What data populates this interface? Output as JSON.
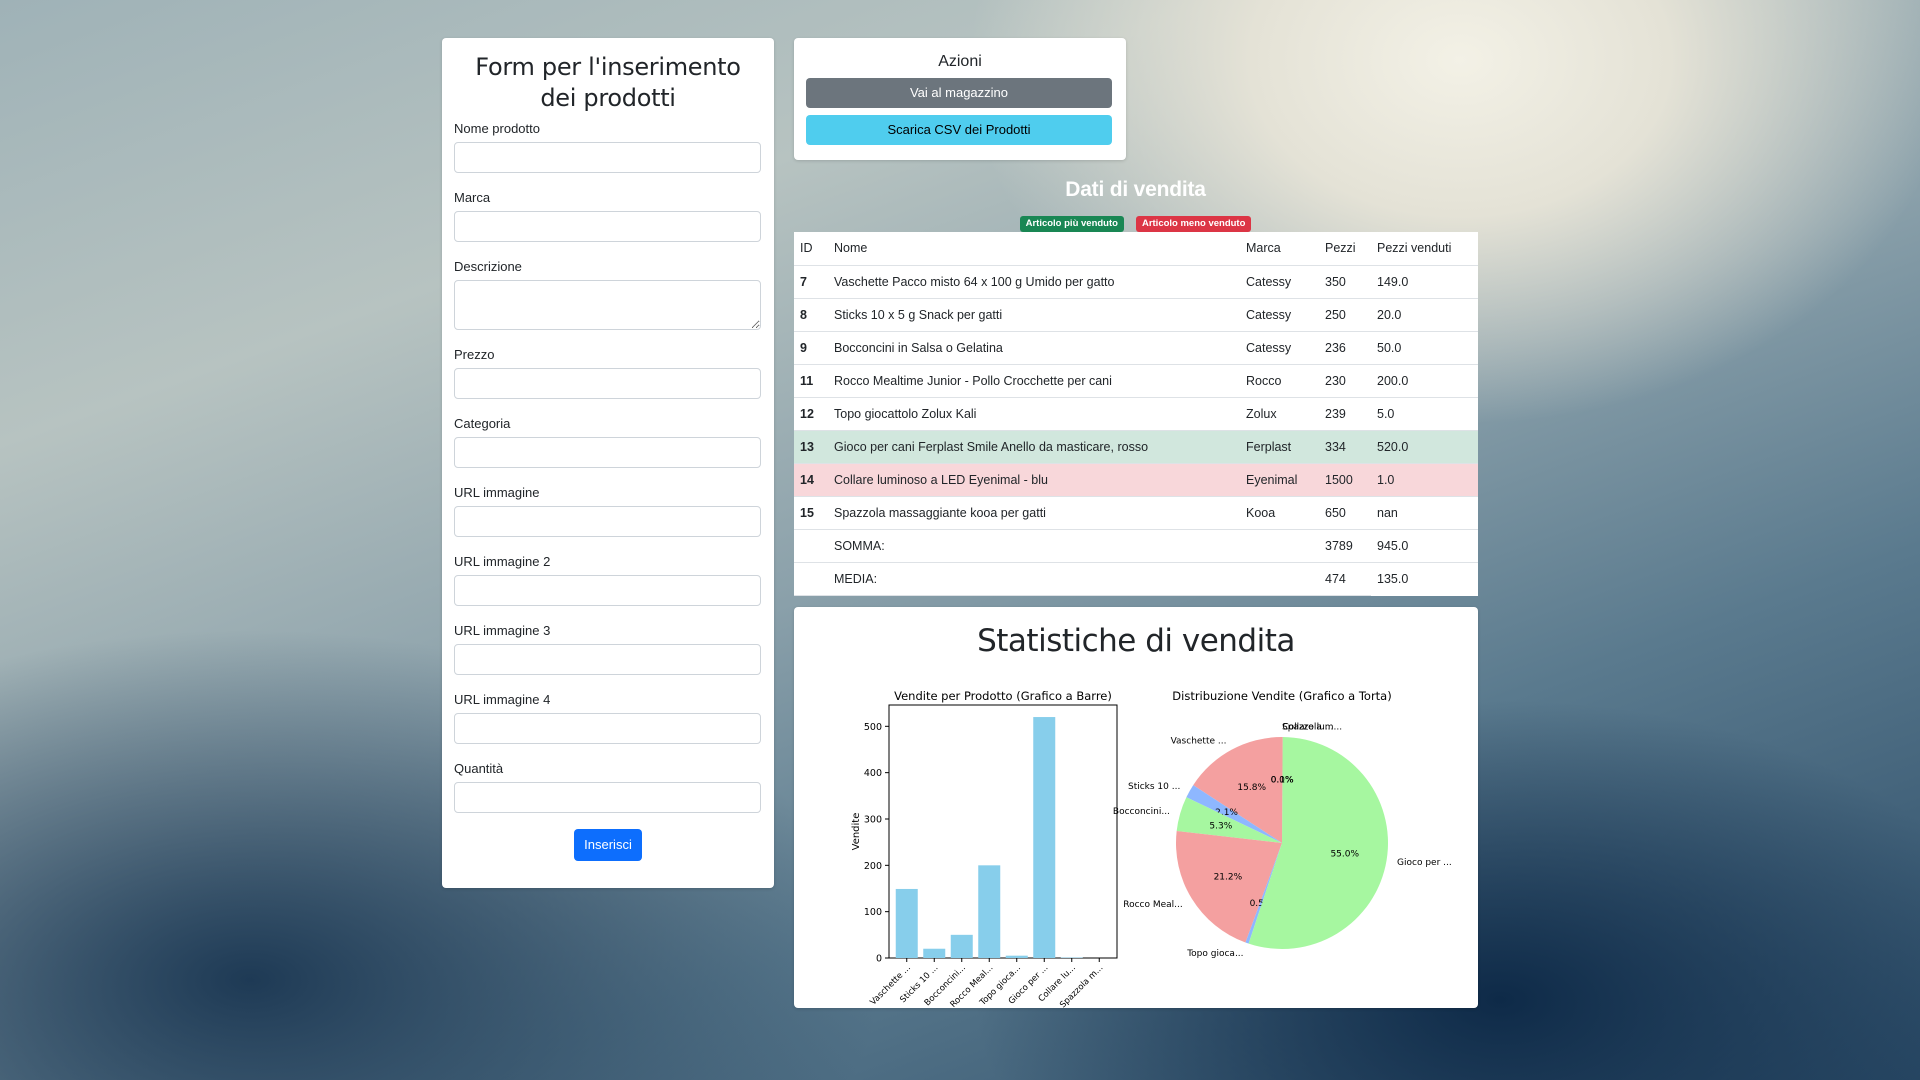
{
  "form": {
    "title": "Form per l'inserimento dei prodotti",
    "fields": [
      {
        "label": "Nome prodotto"
      },
      {
        "label": "Marca"
      },
      {
        "label": "Descrizione"
      },
      {
        "label": "Prezzo"
      },
      {
        "label": "Categoria"
      },
      {
        "label": "URL immagine"
      },
      {
        "label": "URL immagine 2"
      },
      {
        "label": "URL immagine 3"
      },
      {
        "label": "URL immagine 4"
      },
      {
        "label": "Quantità"
      }
    ],
    "submit_label": "Inserisci"
  },
  "actions": {
    "title": "Azioni",
    "warehouse_label": "Vai al magazzino",
    "csv_label": "Scarica CSV dei Prodotti"
  },
  "sales": {
    "title": "Dati di vendita",
    "badge_best": "Articolo più venduto",
    "badge_worst": "Articolo meno venduto",
    "headers": {
      "id": "ID",
      "nome": "Nome",
      "marca": "Marca",
      "pezzi": "Pezzi",
      "venduti": "Pezzi venduti"
    },
    "rows": [
      {
        "id": "7",
        "nome": "Vaschette Pacco misto 64 x 100 g Umido per gatto",
        "marca": "Catessy",
        "pezzi": "350",
        "venduti": "149.0",
        "status": ""
      },
      {
        "id": "8",
        "nome": "Sticks 10 x 5 g Snack per gatti",
        "marca": "Catessy",
        "pezzi": "250",
        "venduti": "20.0",
        "status": ""
      },
      {
        "id": "9",
        "nome": "Bocconcini in Salsa o Gelatina",
        "marca": "Catessy",
        "pezzi": "236",
        "venduti": "50.0",
        "status": ""
      },
      {
        "id": "11",
        "nome": "Rocco Mealtime Junior - Pollo Crocchette per cani",
        "marca": "Rocco",
        "pezzi": "230",
        "venduti": "200.0",
        "status": ""
      },
      {
        "id": "12",
        "nome": "Topo giocattolo Zolux Kali",
        "marca": "Zolux",
        "pezzi": "239",
        "venduti": "5.0",
        "status": ""
      },
      {
        "id": "13",
        "nome": "Gioco per cani Ferplast Smile Anello da masticare, rosso",
        "marca": "Ferplast",
        "pezzi": "334",
        "venduti": "520.0",
        "status": "best"
      },
      {
        "id": "14",
        "nome": "Collare luminoso a LED Eyenimal - blu",
        "marca": "Eyenimal",
        "pezzi": "1500",
        "venduti": "1.0",
        "status": "worst"
      },
      {
        "id": "15",
        "nome": "Spazzola massaggiante kooa per gatti",
        "marca": "Kooa",
        "pezzi": "650",
        "venduti": "nan",
        "status": ""
      }
    ],
    "totals": [
      {
        "label": "SOMMA:",
        "pezzi": "3789",
        "venduti": "945.0"
      },
      {
        "label": "MEDIA:",
        "pezzi": "474",
        "venduti": "135.0"
      }
    ]
  },
  "stats": {
    "title": "Statistiche di vendita"
  },
  "colors": {
    "bar": "#87ceeb",
    "pie_red": "#f4a0a0",
    "pie_green": "#a6f7a0",
    "pie_blue": "#8eb7ff"
  },
  "chart_data": [
    {
      "type": "bar",
      "title": "Vendite per Prodotto (Grafico a Barre)",
      "xlabel": "",
      "ylabel": "Vendite",
      "categories": [
        "Vaschette ...",
        "Sticks 10 ...",
        "Bocconcini...",
        "Rocco Meal...",
        "Topo gioca...",
        "Gioco per ...",
        "Collare lu...",
        "Spazzola m..."
      ],
      "values": [
        149,
        20,
        50,
        200,
        5,
        520,
        1,
        0
      ],
      "ylim": [
        0,
        546
      ],
      "yticks": [
        0,
        100,
        200,
        300,
        400,
        500
      ]
    },
    {
      "type": "pie",
      "title": "Distribuzione Vendite (Grafico a Torta)",
      "labels": [
        "Vaschette ...",
        "Sticks 10 ...",
        "Bocconcini...",
        "Rocco Meal...",
        "Topo gioca...",
        "Gioco per ...",
        "Collare lu...",
        "Spazzola m..."
      ],
      "values": [
        15.8,
        2.1,
        5.3,
        21.2,
        0.5,
        55.0,
        0.1,
        0.0
      ],
      "pct_labels": [
        "15.8%",
        "2.1%",
        "5.3%",
        "21.2%",
        "0.5%",
        "55.0%",
        "0.1%",
        "0.0%"
      ]
    }
  ]
}
